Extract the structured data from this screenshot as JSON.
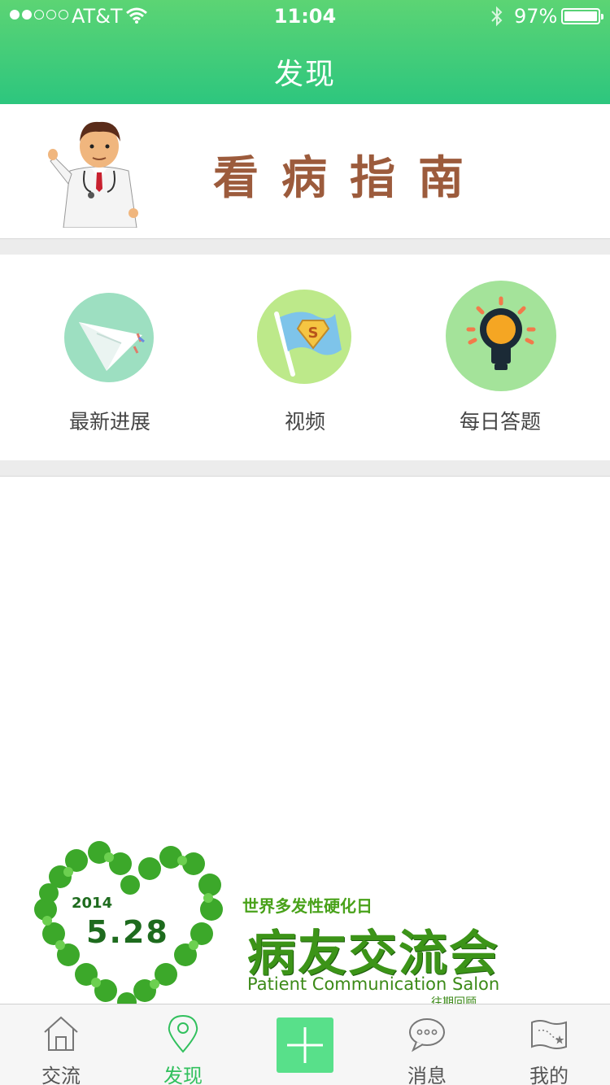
{
  "status_bar": {
    "carrier": "AT&T",
    "time": "11:04",
    "battery": "97%",
    "battery_level": 0.97
  },
  "nav": {
    "title": "发现"
  },
  "guide": {
    "title": "看病指南"
  },
  "features": [
    {
      "label": "最新进展",
      "icon": "paper-plane-icon"
    },
    {
      "label": "视频",
      "icon": "flag-icon"
    },
    {
      "label": "每日答题",
      "icon": "lightbulb-icon"
    }
  ],
  "promo": {
    "year": "2014",
    "date": "5.28",
    "subtitle": "世界多发性硬化日",
    "title": "病友交流会",
    "english": "Patient Communication Salon",
    "review": "往期回顾"
  },
  "tabbar": [
    {
      "label": "交流",
      "icon": "home-icon",
      "active": false
    },
    {
      "label": "发现",
      "icon": "location-pin-icon",
      "active": true
    },
    {
      "label": "",
      "icon": "plus-icon",
      "active": false
    },
    {
      "label": "消息",
      "icon": "chat-bubble-icon",
      "active": false
    },
    {
      "label": "我的",
      "icon": "map-icon",
      "active": false
    }
  ],
  "colors": {
    "header_top": "#5cd474",
    "header_bottom": "#2dc67e",
    "accent": "#31c05d",
    "guide_title": "#9c5b3c"
  }
}
